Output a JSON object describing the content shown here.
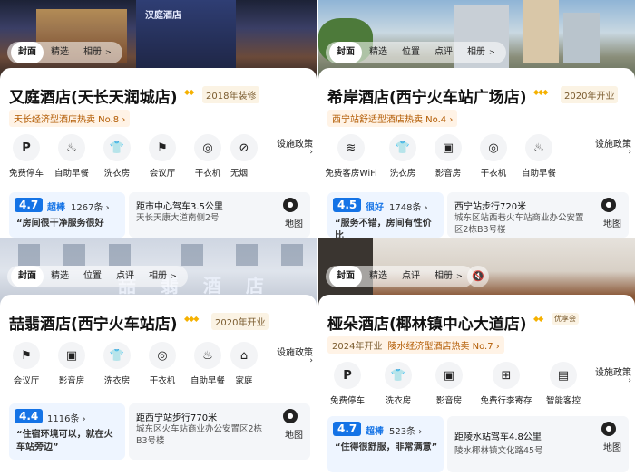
{
  "panels": [
    {
      "tabs": [
        "封面",
        "精选",
        "相册"
      ],
      "photo_sign": "汉庭酒店",
      "name": "又庭酒店(天长天润城店)",
      "year": "2018年装修",
      "rank": "天长经济型酒店热卖 No.8",
      "features": [
        {
          "icon": "parking-icon",
          "glyph": "P",
          "label": "免费停车"
        },
        {
          "icon": "breakfast-icon",
          "glyph": "♨",
          "label": "自助早餐"
        },
        {
          "icon": "laundry-icon",
          "glyph": "👕",
          "label": "洗衣房"
        },
        {
          "icon": "meeting-room-icon",
          "glyph": "⚑",
          "label": "会议厅"
        },
        {
          "icon": "dryer-icon",
          "glyph": "◎",
          "label": "干衣机"
        },
        {
          "icon": "smoke-free-icon",
          "glyph": "⊘",
          "label": "无烟"
        }
      ],
      "more": "设施政策",
      "score": "4.7",
      "score_word": "超棒",
      "review_count": "1267条",
      "quote": "“房间很干净服务很好",
      "distance": "距市中心驾车3.5公里",
      "address": "天长天康大道南侧2号",
      "map": "地图"
    },
    {
      "tabs": [
        "封面",
        "精选",
        "位置",
        "点评",
        "相册"
      ],
      "name": "希岸酒店(西宁火车站广场店)",
      "year": "2020年开业",
      "rank": "西宁站舒适型酒店热卖 No.4",
      "features": [
        {
          "icon": "wifi-icon",
          "glyph": "≋",
          "label": "免费客房WiFi"
        },
        {
          "icon": "laundry-icon",
          "glyph": "👕",
          "label": "洗衣房"
        },
        {
          "icon": "cinema-icon",
          "glyph": "▣",
          "label": "影音房"
        },
        {
          "icon": "dryer-icon",
          "glyph": "◎",
          "label": "干衣机"
        },
        {
          "icon": "breakfast-icon",
          "glyph": "♨",
          "label": "自助早餐"
        }
      ],
      "more": "设施政策",
      "score": "4.5",
      "score_word": "很好",
      "review_count": "1748条",
      "quote": "“服务不错，房间有性价比",
      "distance": "西宁站步行720米",
      "address": "城东区站西巷火车站商业办公安置区2栋B3号楼",
      "map": "地图"
    },
    {
      "tabs": [
        "封面",
        "精选",
        "位置",
        "点评",
        "相册"
      ],
      "photo_sign": "喆 翡 酒 店",
      "name": "喆翡酒店(西宁火车站店)",
      "year": "2020年开业",
      "features": [
        {
          "icon": "meeting-room-icon",
          "glyph": "⚑",
          "label": "会议厅"
        },
        {
          "icon": "cinema-icon",
          "glyph": "▣",
          "label": "影音房"
        },
        {
          "icon": "laundry-icon",
          "glyph": "👕",
          "label": "洗衣房"
        },
        {
          "icon": "dryer-icon",
          "glyph": "◎",
          "label": "干衣机"
        },
        {
          "icon": "breakfast-icon",
          "glyph": "♨",
          "label": "自助早餐"
        },
        {
          "icon": "family-room-icon",
          "glyph": "⌂",
          "label": "家庭"
        }
      ],
      "more": "设施政策",
      "score": "4.4",
      "review_count": "1116条",
      "quote": "“住宿环境可以，就在火车站旁边”",
      "distance": "距西宁站步行770米",
      "address": "城东区火车站商业办公安置区2栋B3号楼",
      "map": "地图"
    },
    {
      "tabs": [
        "封面",
        "精选",
        "点评",
        "相册"
      ],
      "mute": "🔇",
      "name": "桠朵酒店(椰林镇中心大道店)",
      "badge": "优享会",
      "year": "2024年开业",
      "rank": "陵水经济型酒店热卖 No.7",
      "features": [
        {
          "icon": "parking-icon",
          "glyph": "P",
          "label": "免费停车"
        },
        {
          "icon": "laundry-icon",
          "glyph": "👕",
          "label": "洗衣房"
        },
        {
          "icon": "cinema-icon",
          "glyph": "▣",
          "label": "影音房"
        },
        {
          "icon": "luggage-icon",
          "glyph": "⊞",
          "label": "免费行李寄存"
        },
        {
          "icon": "smart-control-icon",
          "glyph": "▤",
          "label": "智能客控"
        }
      ],
      "more": "设施政策",
      "score": "4.7",
      "score_word": "超棒",
      "review_count": "523条",
      "quote": "“住得很舒服，非常满意”",
      "distance": "距陵水站驾车4.8公里",
      "address": "陵水椰林镇文化路45号",
      "map": "地图"
    }
  ]
}
